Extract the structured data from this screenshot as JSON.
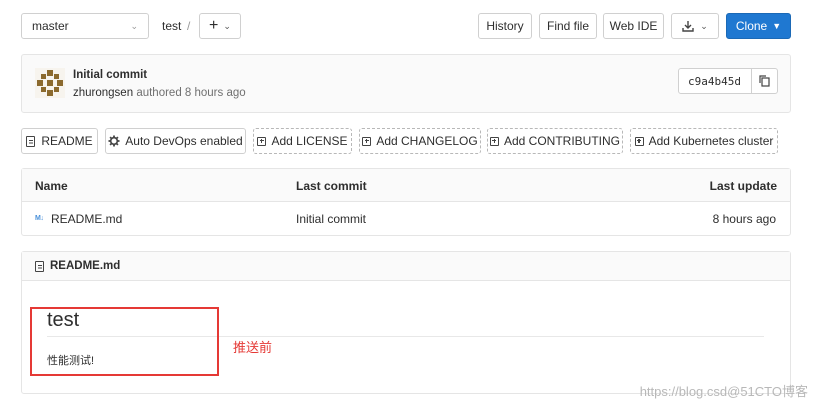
{
  "branch": {
    "value": "master"
  },
  "path": {
    "project": "test",
    "separator": "/"
  },
  "toolbar": {
    "history": "History",
    "find_file": "Find file",
    "web_ide": "Web IDE",
    "clone": "Clone"
  },
  "commit": {
    "title": "Initial commit",
    "author": "zhurongsen",
    "authored_text": "authored 8 hours ago",
    "sha": "c9a4b45d"
  },
  "quick_links": [
    {
      "label": "README"
    },
    {
      "label": "Auto DevOps enabled"
    },
    {
      "label": "Add LICENSE"
    },
    {
      "label": "Add CHANGELOG"
    },
    {
      "label": "Add CONTRIBUTING"
    },
    {
      "label": "Add Kubernetes cluster"
    }
  ],
  "table": {
    "headers": {
      "name": "Name",
      "last_commit": "Last commit",
      "last_update": "Last update"
    },
    "rows": [
      {
        "name": "README.md",
        "last_commit": "Initial commit",
        "last_update": "8 hours ago"
      }
    ]
  },
  "readme": {
    "filename": "README.md",
    "heading": "test",
    "body": "性能测试!"
  },
  "annotation": {
    "text": "推送前",
    "color": "#e53935"
  },
  "watermark": "https://blog.csd@51CTO博客",
  "colors": {
    "accent": "#1f78d1",
    "annotation": "#e53935"
  }
}
